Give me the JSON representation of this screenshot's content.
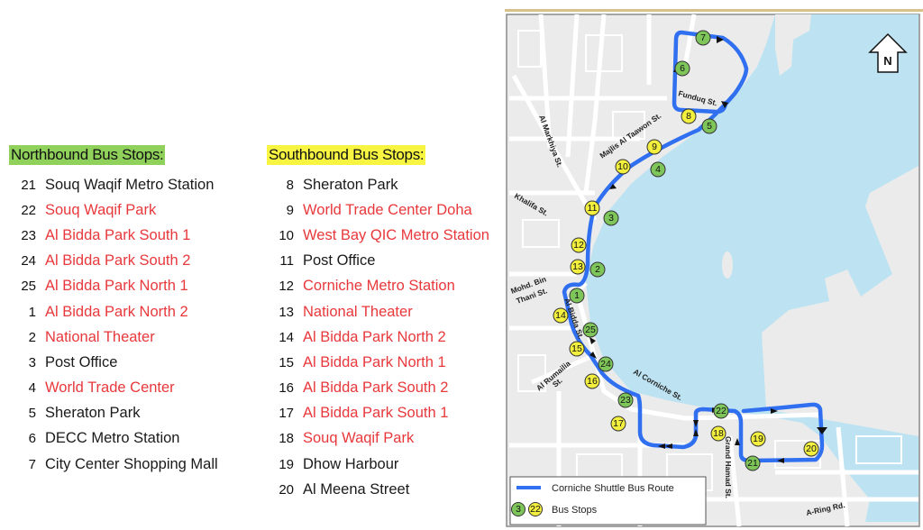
{
  "northbound": {
    "title": "Northbound Bus Stops:",
    "highlight_color": "#8fd15a",
    "stops": [
      {
        "num": "21",
        "name": "Souq Waqif Metro Station",
        "color": "black"
      },
      {
        "num": "22",
        "name": "Souq Waqif Park",
        "color": "red"
      },
      {
        "num": "23",
        "name": "Al Bidda Park South 1",
        "color": "red"
      },
      {
        "num": "24",
        "name": "Al Bidda Park South 2",
        "color": "red"
      },
      {
        "num": "25",
        "name": "Al Bidda Park North 1",
        "color": "red"
      },
      {
        "num": "1",
        "name": "Al Bidda Park North 2",
        "color": "red"
      },
      {
        "num": "2",
        "name": "National Theater",
        "color": "red"
      },
      {
        "num": "3",
        "name": "Post Office",
        "color": "black"
      },
      {
        "num": "4",
        "name": "World Trade Center",
        "color": "red"
      },
      {
        "num": "5",
        "name": "Sheraton Park",
        "color": "black"
      },
      {
        "num": "6",
        "name": "DECC Metro Station",
        "color": "black"
      },
      {
        "num": "7",
        "name": "City Center Shopping Mall",
        "color": "black"
      }
    ]
  },
  "southbound": {
    "title": "Southbound Bus Stops:",
    "highlight_color": "#f7f542",
    "stops": [
      {
        "num": "8",
        "name": "Sheraton Park",
        "color": "black"
      },
      {
        "num": "9",
        "name": "World Trade Center Doha",
        "color": "red"
      },
      {
        "num": "10",
        "name": "West Bay QIC Metro Station",
        "color": "red"
      },
      {
        "num": "11",
        "name": "Post Office",
        "color": "black"
      },
      {
        "num": "12",
        "name": "Corniche Metro Station",
        "color": "red"
      },
      {
        "num": "13",
        "name": "National Theater",
        "color": "red"
      },
      {
        "num": "14",
        "name": "Al Bidda Park North 2",
        "color": "red"
      },
      {
        "num": "15",
        "name": "Al Bidda Park North 1",
        "color": "red"
      },
      {
        "num": "16",
        "name": "Al Bidda Park South 2",
        "color": "red"
      },
      {
        "num": "17",
        "name": "Al Bidda Park South 1",
        "color": "red"
      },
      {
        "num": "18",
        "name": "Souq Waqif Park",
        "color": "red"
      },
      {
        "num": "19",
        "name": "Dhow Harbour",
        "color": "black"
      },
      {
        "num": "20",
        "name": "Al Meena Street",
        "color": "black"
      }
    ]
  },
  "colors": {
    "red_text": "#e8383b",
    "route": "#2f6ff0",
    "northbound_stop": "#7fc65a",
    "southbound_stop": "#f2ef3e",
    "water": "#bde3f2",
    "land": "#ebebeb"
  },
  "map": {
    "north_label": "N",
    "street_labels": {
      "funduq": "Funduq St.",
      "majlis": "Majlis Al Taawon St.",
      "markhiya": "Al Markhiya St.",
      "khalifa": "Khalifa St.",
      "mohd_1": "Mohd. Bin",
      "mohd_2": "Thani St.",
      "bidda": "Al Bidda St.",
      "rumailia_1": "Al Rumailia",
      "rumailia_2": "St.",
      "corniche": "Al Corniche St.",
      "grand_hamad": "Grand Hamad St.",
      "a_ring": "A-Ring Rd."
    },
    "stops_north": [
      "1",
      "2",
      "3",
      "4",
      "5",
      "6",
      "7",
      "21",
      "22",
      "23",
      "24",
      "25"
    ],
    "stops_south": [
      "8",
      "9",
      "10",
      "11",
      "12",
      "13",
      "14",
      "15",
      "16",
      "17",
      "18",
      "19",
      "20"
    ],
    "legend": {
      "route_label": "Corniche Shuttle Bus Route",
      "stops_label": "Bus Stops",
      "sample_green": "3",
      "sample_yellow": "22"
    }
  }
}
